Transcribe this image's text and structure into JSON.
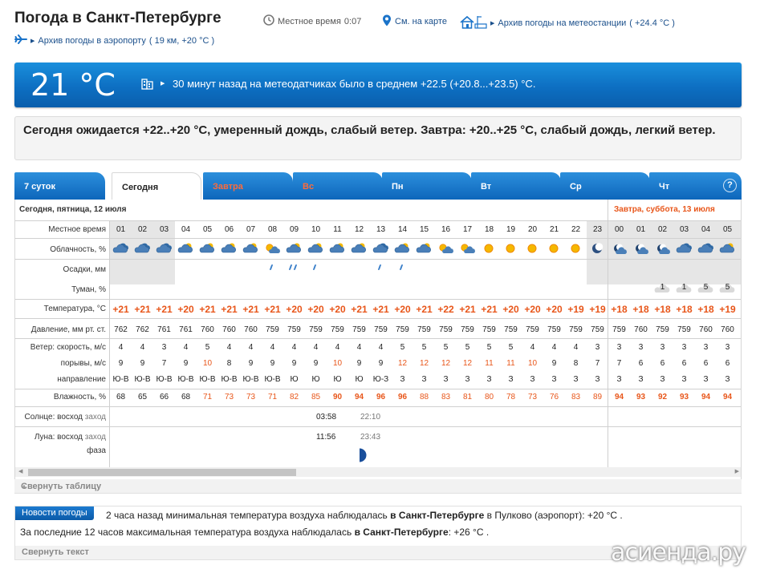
{
  "header": {
    "title": "Погода в Санкт-Петербурге",
    "local_time_label": "Местное время",
    "local_time_value": "0:07",
    "map_link": "См. на карте",
    "station_archive": "Архив погоды на метеостанции",
    "station_temp": "( +24.4 °С )",
    "airport_archive": "Архив погоды в аэропорту",
    "airport_info": "( 19 км, +20 °С )"
  },
  "now": {
    "temperature": "21 °C",
    "summary": "30 минут назад на метеодатчиках было в среднем +22.5 (+20.8...+23.5) °C."
  },
  "forecast_text": "Сегодня ожидается +22..+20 °C, умеренный дождь, слабый ветер. Завтра: +20..+25 °C, слабый дождь, легкий ветер.",
  "tabs": [
    {
      "label": "7 суток"
    },
    {
      "label": "Сегодня"
    },
    {
      "label": "Завтра"
    },
    {
      "label": "Вс"
    },
    {
      "label": "Пн"
    },
    {
      "label": "Вт"
    },
    {
      "label": "Ср"
    },
    {
      "label": "Чт"
    }
  ],
  "help_label": "?",
  "table": {
    "day_today": "Сегодня, пятница, 12 июля",
    "day_tomorrow": "Завтра, суббота, 13 июля",
    "labels": {
      "time": "Местное время",
      "cloud": "Облачность, %",
      "precip": "Осадки, мм",
      "fog": "Туман, %",
      "temp": "Температура, °С",
      "pressure": "Давление, мм рт. ст.",
      "wind": "Ветер: скорость, м/с",
      "gusts": "порывы, м/с",
      "direction": "направление",
      "humidity": "Влажность, %",
      "sun_prefix": "Солнце:",
      "sun_rise": "восход",
      "sun_set": "заход",
      "moon_prefix": "Луна:",
      "moon_rise": "восход",
      "moon_set": "заход",
      "moon_phase": "фаза"
    },
    "hours": [
      "01",
      "02",
      "03",
      "04",
      "05",
      "06",
      "07",
      "08",
      "09",
      "10",
      "11",
      "12",
      "13",
      "14",
      "15",
      "16",
      "17",
      "18",
      "19",
      "20",
      "21",
      "22",
      "23",
      "00",
      "01",
      "02",
      "03",
      "04",
      "05"
    ],
    "cloud_icons": [
      "cloudy-icon",
      "cloudy-icon",
      "cloudy-icon",
      "partly-cloudy-icon",
      "partly-cloudy-icon",
      "partly-cloudy-icon",
      "partly-cloudy-icon",
      "sun-cloud-icon",
      "partly-cloudy-icon",
      "partly-cloudy-icon",
      "partly-cloudy-icon",
      "partly-cloudy-icon",
      "cloudy-icon",
      "partly-cloudy-icon",
      "partly-cloudy-icon",
      "sun-cloud-icon",
      "sun-cloud-icon",
      "sun-icon",
      "sun-icon",
      "sun-icon",
      "sun-icon",
      "sun-icon",
      "moon-icon",
      "moon-cloud-icon",
      "moon-cloud-icon",
      "moon-cloud-icon",
      "cloudy-icon",
      "cloudy-icon",
      "partly-cloudy-icon"
    ],
    "precip": [
      0,
      0,
      0,
      0,
      0,
      0,
      0,
      1,
      2,
      1,
      0,
      0,
      1,
      1,
      0,
      0,
      0,
      0,
      0,
      0,
      0,
      0,
      0,
      0,
      0,
      0,
      0,
      0,
      0
    ],
    "fog": [
      "",
      "",
      "",
      "",
      "",
      "",
      "",
      "",
      "",
      "",
      "",
      "",
      "",
      "",
      "",
      "",
      "",
      "",
      "",
      "",
      "",
      "",
      "",
      "",
      "",
      "1",
      "1",
      "5",
      "5"
    ],
    "temps": [
      "+21",
      "+21",
      "+21",
      "+20",
      "+21",
      "+21",
      "+21",
      "+21",
      "+20",
      "+20",
      "+20",
      "+21",
      "+21",
      "+20",
      "+21",
      "+22",
      "+21",
      "+21",
      "+20",
      "+20",
      "+20",
      "+19",
      "+19",
      "+18",
      "+18",
      "+18",
      "+18",
      "+18",
      "+19"
    ],
    "pressure": [
      "762",
      "762",
      "761",
      "761",
      "760",
      "760",
      "760",
      "759",
      "759",
      "759",
      "759",
      "759",
      "759",
      "759",
      "759",
      "759",
      "759",
      "759",
      "759",
      "759",
      "759",
      "759",
      "759",
      "759",
      "760",
      "759",
      "759",
      "760",
      "760"
    ],
    "wind": [
      "4",
      "4",
      "3",
      "4",
      "5",
      "4",
      "4",
      "4",
      "4",
      "4",
      "4",
      "4",
      "4",
      "5",
      "5",
      "5",
      "5",
      "5",
      "5",
      "4",
      "4",
      "4",
      "3",
      "3",
      "3",
      "3",
      "3",
      "3",
      "3"
    ],
    "gusts": [
      "9",
      "9",
      "7",
      "9",
      "10",
      "8",
      "9",
      "9",
      "9",
      "9",
      "10",
      "9",
      "9",
      "12",
      "12",
      "12",
      "12",
      "11",
      "11",
      "10",
      "9",
      "8",
      "7",
      "7",
      "6",
      "6",
      "6",
      "6",
      "6"
    ],
    "direction": [
      "Ю-В",
      "Ю-В",
      "Ю-В",
      "Ю-В",
      "Ю-В",
      "Ю-В",
      "Ю-В",
      "Ю-В",
      "Ю",
      "Ю",
      "Ю",
      "Ю",
      "Ю-З",
      "З",
      "З",
      "З",
      "З",
      "З",
      "З",
      "З",
      "З",
      "З",
      "З",
      "З",
      "З",
      "З",
      "З",
      "З",
      "З"
    ],
    "humidity": [
      "68",
      "65",
      "66",
      "68",
      "71",
      "73",
      "73",
      "71",
      "82",
      "85",
      "90",
      "94",
      "96",
      "96",
      "88",
      "83",
      "81",
      "80",
      "78",
      "73",
      "76",
      "83",
      "89",
      "94",
      "93",
      "92",
      "93",
      "94",
      "94"
    ],
    "sun_rise": "03:58",
    "sun_set": "22:10",
    "moon_rise": "11:56",
    "moon_set": "23:43",
    "collapse_label": "Свернуть таблицу"
  },
  "news": {
    "badge": "Новости погоды",
    "line1_pre": "2 часа назад минимальная температура воздуха наблюдалась",
    "line1_city": "в Санкт-Петербурге",
    "line1_post": "в Пулково (аэропорт): +20 °С .",
    "line2_pre": "За последние 12 часов максимальная температура воздуха наблюдалась",
    "line2_city": "в Санкт-Петербурге",
    "line2_post": ": +26 °С .",
    "collapse_label": "Свернуть текст"
  },
  "watermark": "асиенда.ру",
  "colors": {
    "panel_blue": "#0d6fc2",
    "warm_text": "#e8561a",
    "link": "#1a4f8b"
  }
}
